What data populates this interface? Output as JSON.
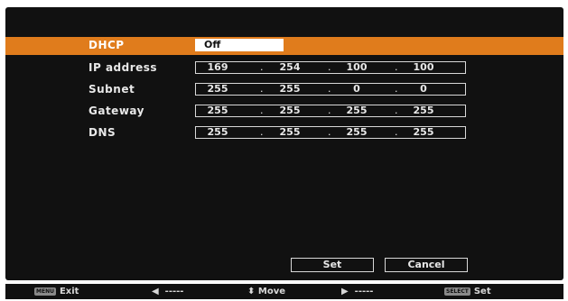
{
  "dhcp": {
    "label": "DHCP",
    "value": "Off"
  },
  "ip_address": {
    "label": "IP address",
    "octets": [
      "169",
      "254",
      "100",
      "100"
    ]
  },
  "subnet": {
    "label": "Subnet",
    "octets": [
      "255",
      "255",
      "0",
      "0"
    ]
  },
  "gateway": {
    "label": "Gateway",
    "octets": [
      "255",
      "255",
      "255",
      "255"
    ]
  },
  "dns": {
    "label": "DNS",
    "octets": [
      "255",
      "255",
      "255",
      "255"
    ]
  },
  "buttons": {
    "set": "Set",
    "cancel": "Cancel"
  },
  "footer": {
    "exit_key": "MENU",
    "exit_label": "Exit",
    "left_arrow": "◀",
    "left_label": "-----",
    "move_icon": "⬍",
    "move_label": "Move",
    "right_arrow": "▶",
    "right_label": "-----",
    "select_key": "SELECT",
    "select_label": "Set"
  },
  "colors": {
    "highlight": "#e07c1c",
    "panel": "#111111"
  }
}
